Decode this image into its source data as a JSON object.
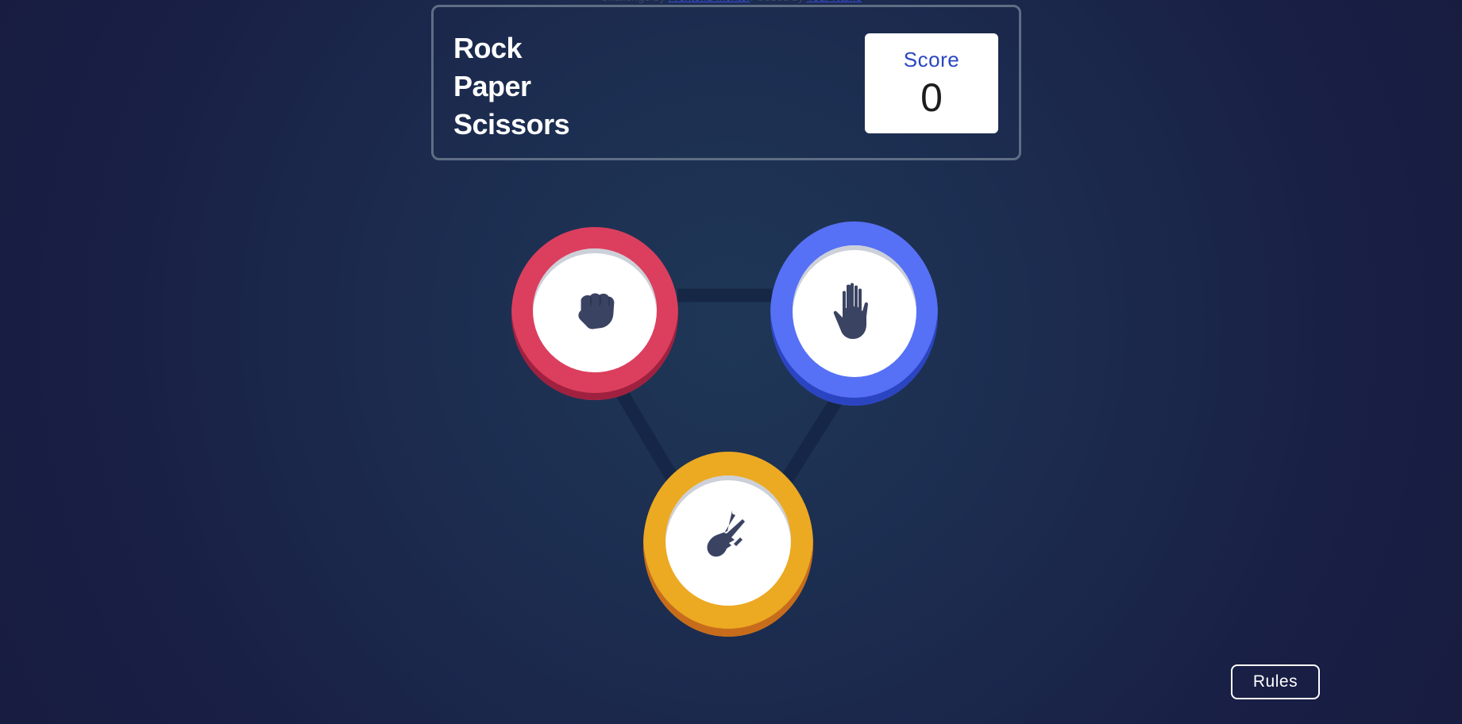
{
  "header": {
    "title_lines": [
      "Rock",
      "Paper",
      "Scissors"
    ],
    "score_label": "Score",
    "score_value": "0"
  },
  "choices": [
    {
      "id": "rock",
      "icon": "fist-icon",
      "color": "#dc3f5e"
    },
    {
      "id": "paper",
      "icon": "open-hand-icon",
      "color": "#5671f5"
    },
    {
      "id": "scissors",
      "icon": "scissors-hand-icon",
      "color": "#eca922"
    }
  ],
  "colors": {
    "background": "#1f3756",
    "rock": "#dc3f5e",
    "paper": "#5671f5",
    "scissors": "#eca922",
    "icon": "#3b4363",
    "score_label": "#2a46c0"
  },
  "footer": {
    "rules_label": "Rules"
  }
}
